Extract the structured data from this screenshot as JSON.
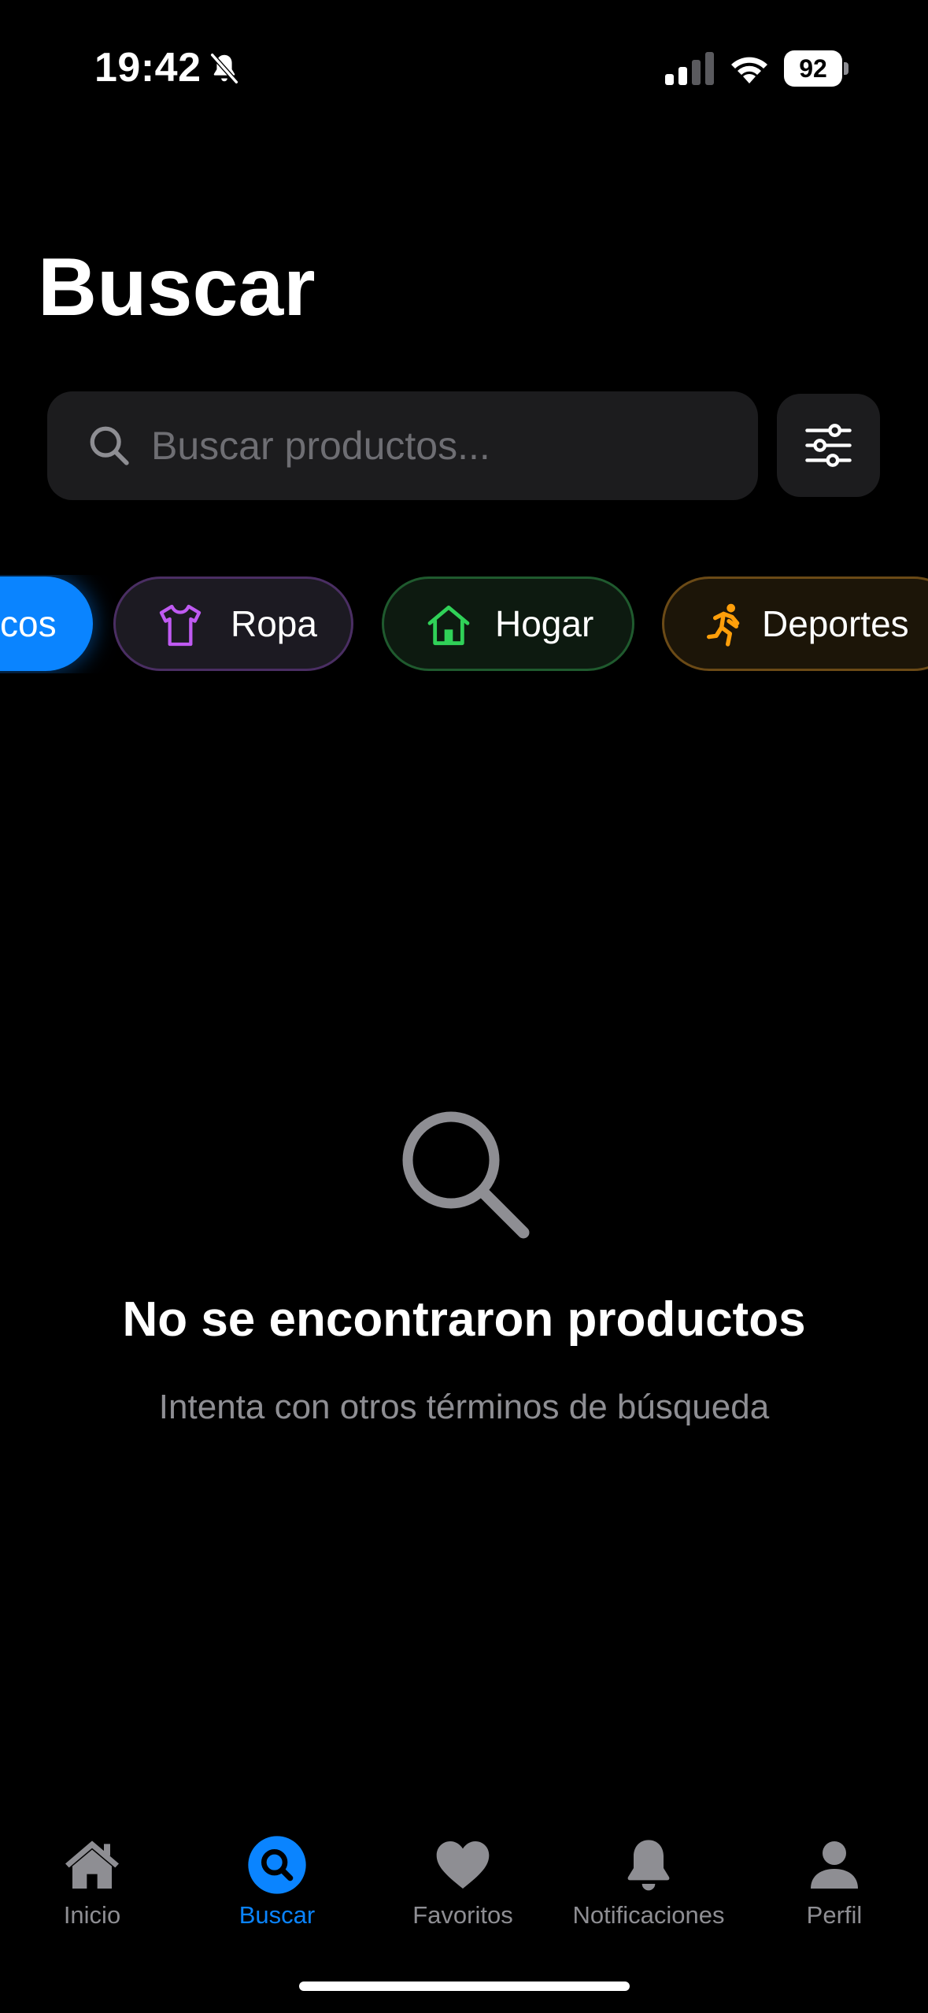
{
  "status_bar": {
    "time": "19:42",
    "battery": "92",
    "icons": [
      "bell-slash-icon",
      "cellular-signal-icon",
      "wifi-icon",
      "battery-icon"
    ]
  },
  "page": {
    "title": "Buscar"
  },
  "search": {
    "placeholder": "Buscar productos...",
    "value": "",
    "icon": "magnifying-glass-icon",
    "filter_icon": "sliders-icon"
  },
  "categories": [
    {
      "label": "cos",
      "icon": "",
      "selected": true,
      "color": "#0a84ff"
    },
    {
      "label": "Ropa",
      "icon": "tshirt-icon",
      "selected": false,
      "color": "#bf5af2"
    },
    {
      "label": "Hogar",
      "icon": "house-icon",
      "selected": false,
      "color": "#30d158"
    },
    {
      "label": "Deportes",
      "icon": "running-icon",
      "selected": false,
      "color": "#ff9f0a"
    }
  ],
  "empty_state": {
    "icon": "magnifying-glass-icon",
    "title": "No se encontraron productos",
    "subtitle": "Intenta con otros términos de búsqueda"
  },
  "tabbar": {
    "items": [
      {
        "label": "Inicio",
        "icon": "house-icon",
        "active": false
      },
      {
        "label": "Buscar",
        "icon": "search-icon",
        "active": true
      },
      {
        "label": "Favoritos",
        "icon": "heart-icon",
        "active": false
      },
      {
        "label": "Notificaciones",
        "icon": "bell-icon",
        "active": false
      },
      {
        "label": "Perfil",
        "icon": "person-icon",
        "active": false
      }
    ]
  },
  "colors": {
    "accent": "#0a84ff",
    "background": "#000000",
    "surface": "#1c1c1e",
    "secondary_text": "#8e8e93"
  }
}
